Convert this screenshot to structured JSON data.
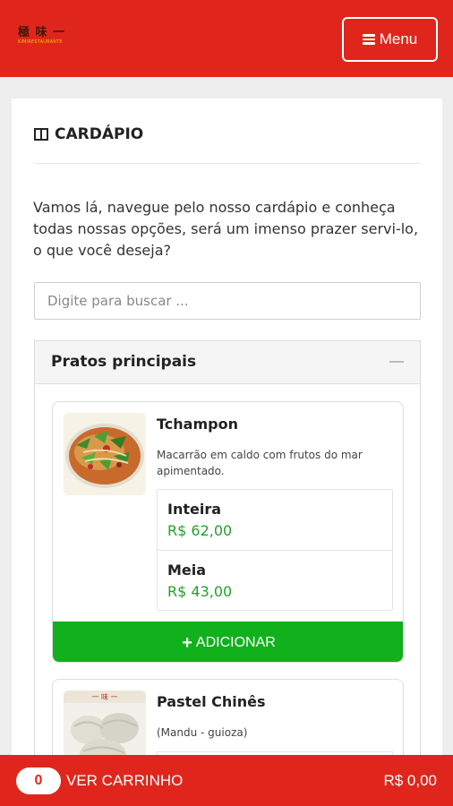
{
  "header": {
    "logo_chars": "極 味 一",
    "logo_tagline": "KIMIRESTAURANTE",
    "menu_label": "Menu"
  },
  "section": {
    "title": "CARDÁPIO",
    "intro": "Vamos lá, navegue pelo nosso cardápio e conheça todas nossas opções, será um imenso prazer servi-lo, o que você deseja?",
    "search_placeholder": "Digite para buscar ..."
  },
  "category": {
    "title": "Pratos principais",
    "products": [
      {
        "name": "Tchampon",
        "description": "Macarrão em caldo com frutos do mar apimentado.",
        "options": [
          {
            "name": "Inteira",
            "price": "R$ 62,00"
          },
          {
            "name": "Meia",
            "price": "R$ 43,00"
          }
        ],
        "add_label": "ADICIONAR"
      },
      {
        "name": "Pastel Chinês",
        "description": "(Mandu - guioza)"
      }
    ]
  },
  "cart": {
    "count": "0",
    "label": "VER CARRINHO",
    "total": "R$ 0,00"
  },
  "colors": {
    "brand_red": "#e0261c",
    "add_green": "#11b01d",
    "price_green": "#21a12a"
  },
  "icons": [
    "menu-icon",
    "book-icon",
    "minus-icon",
    "plus-icon"
  ]
}
